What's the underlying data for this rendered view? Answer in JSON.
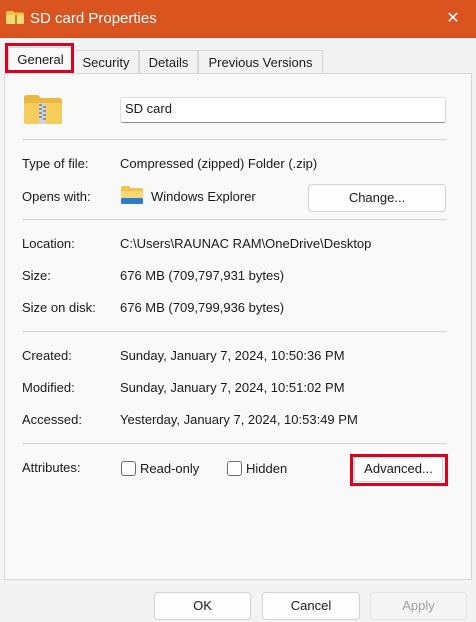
{
  "window": {
    "title": "SD card Properties",
    "close_glyph": "✕"
  },
  "tabs": [
    {
      "label": "General"
    },
    {
      "label": "Security"
    },
    {
      "label": "Details"
    },
    {
      "label": "Previous Versions"
    }
  ],
  "file": {
    "name": "SD card",
    "icon": "zipped-folder-icon"
  },
  "type": {
    "label": "Type of file:",
    "value": "Compressed (zipped) Folder (.zip)"
  },
  "opens": {
    "label": "Opens with:",
    "value": "Windows Explorer",
    "icon": "file-explorer-icon",
    "change_label": "Change..."
  },
  "location": {
    "label": "Location:",
    "value": "C:\\Users\\RAUNAC RAM\\OneDrive\\Desktop"
  },
  "size": {
    "label": "Size:",
    "value": "676 MB (709,797,931 bytes)"
  },
  "size_on_disk": {
    "label": "Size on disk:",
    "value": "676 MB (709,799,936 bytes)"
  },
  "created": {
    "label": "Created:",
    "value": "Sunday, January 7, 2024, 10:50:36 PM"
  },
  "modified": {
    "label": "Modified:",
    "value": "Sunday, January 7, 2024, 10:51:02 PM"
  },
  "accessed": {
    "label": "Accessed:",
    "value": "Yesterday, January 7, 2024, 10:53:49 PM"
  },
  "attributes": {
    "label": "Attributes:",
    "readonly_label": "Read-only",
    "readonly_checked": false,
    "hidden_label": "Hidden",
    "hidden_checked": false,
    "advanced_label": "Advanced..."
  },
  "footer": {
    "ok": "OK",
    "cancel": "Cancel",
    "apply": "Apply"
  },
  "colors": {
    "titlebar": "#d9541f",
    "highlight": "#e0001b"
  }
}
